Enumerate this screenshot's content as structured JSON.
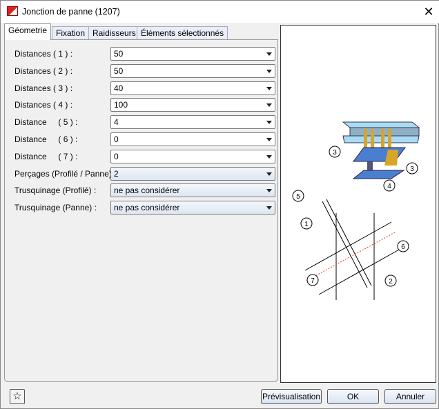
{
  "window": {
    "title": "Jonction de panne (1207)",
    "close_icon": "close-icon",
    "app_icon": "hicad-icon"
  },
  "tabs": [
    {
      "label": "Géometrie",
      "active": true
    },
    {
      "label": "Fixation"
    },
    {
      "label": "Raidisseurs"
    },
    {
      "label": "Éléments sélectionnés"
    }
  ],
  "fields": [
    {
      "label": "Distances ( 1 ) :",
      "value": "50"
    },
    {
      "label": "Distances ( 2 ) :",
      "value": "50"
    },
    {
      "label": "Distances ( 3 ) :",
      "value": "40"
    },
    {
      "label": "Distances ( 4 ) :",
      "value": "100"
    },
    {
      "label": "Distance     ( 5 ) :",
      "value": "4"
    },
    {
      "label": "Distance     ( 6 ) :",
      "value": "0"
    },
    {
      "label": "Distance     ( 7 ) :",
      "value": "0"
    },
    {
      "label": "Perçages (Profilé / Panne)",
      "value": "2"
    },
    {
      "label": "Trusquinage (Profilé) :",
      "value": "ne pas considérer"
    },
    {
      "label": "Trusquinage (Panne) :",
      "value": "ne pas considérer"
    }
  ],
  "preview": {
    "callouts": [
      "3",
      "3",
      "4",
      "5",
      "1",
      "6",
      "7",
      "2"
    ]
  },
  "footer": {
    "favorite_icon": "star-icon",
    "preview_label": "Prévisualisation",
    "ok_label": "OK",
    "cancel_label": "Annuler"
  }
}
